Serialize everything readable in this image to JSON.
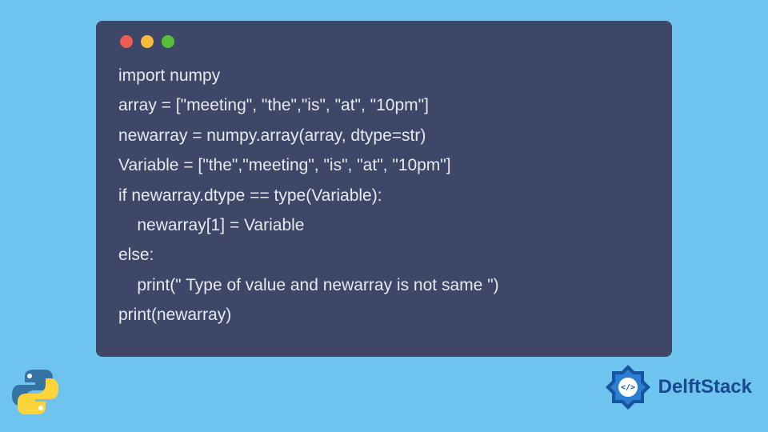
{
  "code": {
    "lines": [
      "import numpy",
      "array = [\"meeting\", \"the\",\"is\", \"at\", \"10pm\"]",
      "newarray = numpy.array(array, dtype=str)",
      "Variable = [\"the\",\"meeting\", \"is\", \"at\", \"10pm\"]",
      "if newarray.dtype == type(Variable):",
      "    newarray[1] = Variable",
      "else:",
      "    print(\" Type of value and newarray is not same \")",
      "print(newarray)"
    ]
  },
  "branding": {
    "name": "DelftStack"
  }
}
